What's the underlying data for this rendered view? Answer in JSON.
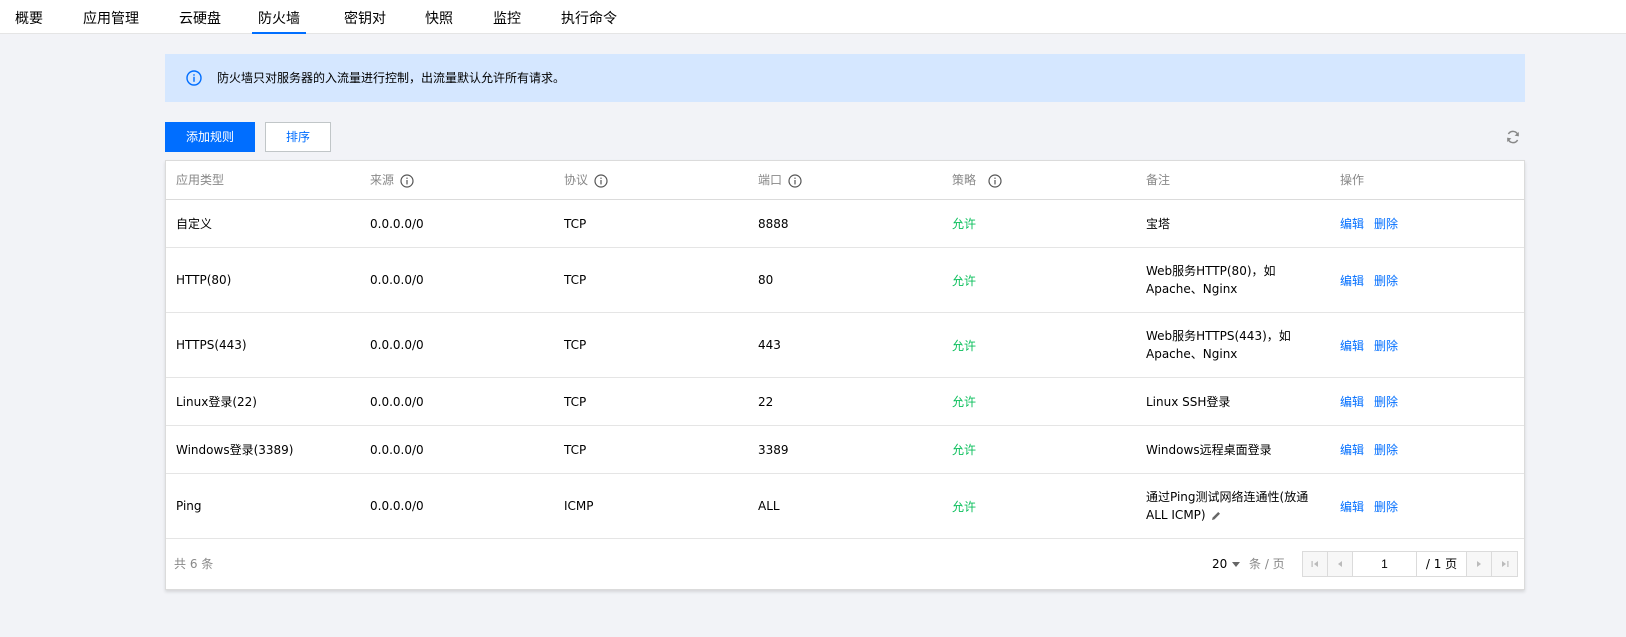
{
  "tabs": [
    {
      "label": "概要",
      "active": false
    },
    {
      "label": "应用管理",
      "active": false
    },
    {
      "label": "云硬盘",
      "active": false
    },
    {
      "label": "防火墙",
      "active": true
    },
    {
      "label": "密钥对",
      "active": false
    },
    {
      "label": "快照",
      "active": false
    },
    {
      "label": "监控",
      "active": false
    },
    {
      "label": "执行命令",
      "active": false
    }
  ],
  "notice": {
    "text": "防火墙只对服务器的入流量进行控制，出流量默认允许所有请求。"
  },
  "toolbar": {
    "add_label": "添加规则",
    "sort_label": "排序"
  },
  "table": {
    "headers": {
      "app_type": "应用类型",
      "source": "来源",
      "protocol": "协议",
      "port": "端口",
      "policy": "策略",
      "note": "备注",
      "actions": "操作"
    },
    "edit_label": "编辑",
    "delete_label": "删除",
    "rows": [
      {
        "app_type": "自定义",
        "source": "0.0.0.0/0",
        "protocol": "TCP",
        "port": "8888",
        "policy": "允许",
        "note": "宝塔"
      },
      {
        "app_type": "HTTP(80)",
        "source": "0.0.0.0/0",
        "protocol": "TCP",
        "port": "80",
        "policy": "允许",
        "note": "Web服务HTTP(80)，如 Apache、Nginx"
      },
      {
        "app_type": "HTTPS(443)",
        "source": "0.0.0.0/0",
        "protocol": "TCP",
        "port": "443",
        "policy": "允许",
        "note": "Web服务HTTPS(443)，如 Apache、Nginx"
      },
      {
        "app_type": "Linux登录(22)",
        "source": "0.0.0.0/0",
        "protocol": "TCP",
        "port": "22",
        "policy": "允许",
        "note": "Linux SSH登录"
      },
      {
        "app_type": "Windows登录(3389)",
        "source": "0.0.0.0/0",
        "protocol": "TCP",
        "port": "3389",
        "policy": "允许",
        "note": "Windows远程桌面登录"
      },
      {
        "app_type": "Ping",
        "source": "0.0.0.0/0",
        "protocol": "ICMP",
        "port": "ALL",
        "policy": "允许",
        "note": "通过Ping测试网络连通性(放通ALL ICMP)"
      }
    ]
  },
  "footer": {
    "total": "共 6 条",
    "page_size": "20",
    "per_page": "条 / 页",
    "current_page": "1",
    "total_pages": "/ 1 页"
  },
  "colors": {
    "accent": "#006eff",
    "allow": "#0abf5b",
    "notice_bg": "#d5e7ff"
  }
}
